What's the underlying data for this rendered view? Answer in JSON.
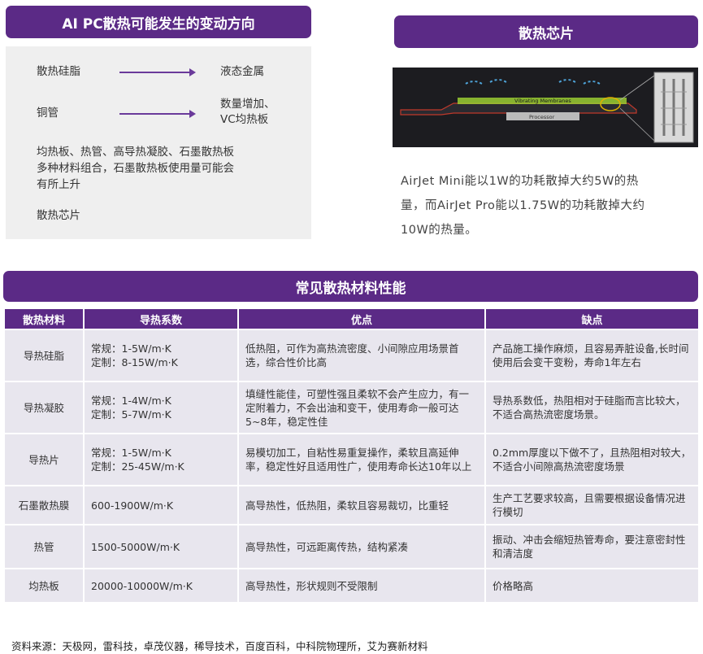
{
  "left": {
    "title": "AI PC散热可能发生的变动方向",
    "row1_from": "散热硅脂",
    "row1_to": "液态金属",
    "row2_from": "铜管",
    "row2_to_line1": "数量增加、",
    "row2_to_line2": "VC均热板",
    "row3_line1": "均热板、热管、高导热凝胶、石墨散热板",
    "row3_line2": "多种材料组合，石墨散热板使用量可能会",
    "row3_line3": "有所上升",
    "row4": "散热芯片"
  },
  "right": {
    "title": "散热芯片",
    "image_label_1": "Vibrating Membranes",
    "image_label_2": "Processor",
    "desc_line1": "AirJet Mini能以1W的功耗散掉大约5W的热",
    "desc_line2": "量，而AirJet Pro能以1.75W的功耗散掉大约",
    "desc_line3": "10W的热量。"
  },
  "table": {
    "title": "常见散热材料性能",
    "headers": [
      "散热材料",
      "导热系数",
      "优点",
      "缺点"
    ],
    "rows": [
      {
        "name": "导热硅脂",
        "k1": "常规：1-5W/m·K",
        "k2": "定制：8-15W/m·K",
        "pros": "低热阻，可作为高热流密度、小间隙应用场景首选，综合性价比高",
        "cons": "产品施工操作麻烦，且容易弄脏设备,长时间使用后会变干变粉，寿命1年左右"
      },
      {
        "name": "导热凝胶",
        "k1": "常规：1-4W/m·K",
        "k2": "定制：5-7W/m·K",
        "pros": "填缝性能佳，可塑性强且柔软不会产生应力，有一定附着力，不会出油和变干，使用寿命一般可达5~8年，稳定性佳",
        "cons": "导热系数低，热阻相对于硅脂而言比较大，不适合高热流密度场景。"
      },
      {
        "name": "导热片",
        "k1": "常规：1-5W/m·K",
        "k2": "定制：25-45W/m·K",
        "pros": "易模切加工，自粘性易重复操作，柔软且高延伸率，稳定性好且适用性广，使用寿命长达10年以上",
        "cons": "0.2mm厚度以下做不了，且热阻相对较大，不适合小间隙高热流密度场景"
      },
      {
        "name": "石墨散热膜",
        "k1": "600-1900W/m·K",
        "k2": "",
        "pros": "高导热性，低热阻，柔软且容易裁切，比重轻",
        "cons": "生产工艺要求较高，且需要根据设备情况进行模切"
      },
      {
        "name": "热管",
        "k1": "1500-5000W/m·K",
        "k2": "",
        "pros": "高导热性，可远距离传热，结构紧凑",
        "cons": "振动、冲击会缩短热管寿命，要注意密封性和清洁度"
      },
      {
        "name": "均热板",
        "k1": "20000-10000W/m·K",
        "k2": "",
        "pros": "高导热性，形状规则不受限制",
        "cons": "价格略高"
      }
    ]
  },
  "source": "资料来源：天极网，雷科技，卓茂仪器，稀导技术，百度百科，中科院物理所，艾为赛新材料",
  "colors": {
    "accent": "#5b2a86",
    "panel": "#efefef",
    "cell": "#e8e6ee"
  }
}
